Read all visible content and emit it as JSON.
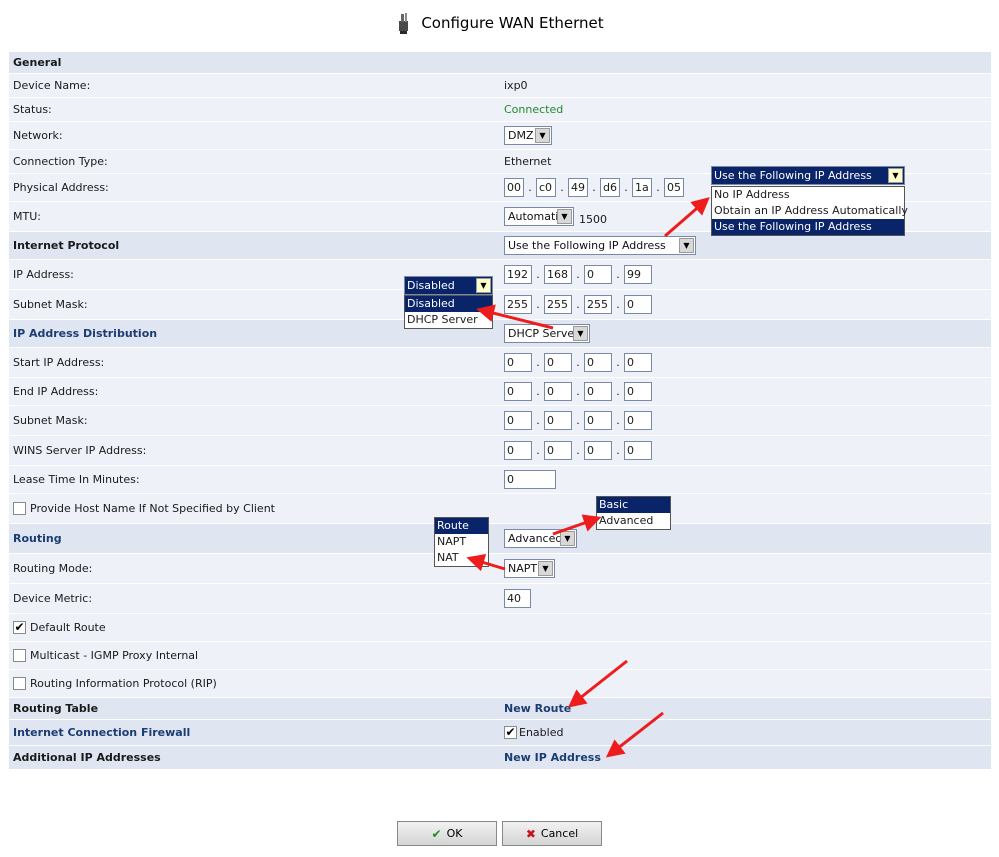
{
  "page": {
    "title": "Configure WAN Ethernet",
    "icon": "ethernet-plug-icon"
  },
  "general": {
    "header": "General",
    "device_name": {
      "label": "Device Name:",
      "value": "ixp0"
    },
    "status": {
      "label": "Status:",
      "value": "Connected",
      "color": "#1f8c2d"
    },
    "network": {
      "label": "Network:",
      "value": "DMZ"
    },
    "connection_type": {
      "label": "Connection Type:",
      "value": "Ethernet"
    },
    "physical_address": {
      "label": "Physical Address:",
      "octets": [
        "00",
        "c0",
        "49",
        "d6",
        "1a",
        "05"
      ]
    },
    "mtu": {
      "label": "MTU:",
      "mode": "Automatic",
      "value": "1500"
    }
  },
  "internet_protocol": {
    "header": "Internet Protocol",
    "mode": "Use the Following IP Address",
    "ip_address": {
      "label": "IP Address:",
      "octets": [
        "192",
        "168",
        "0",
        "99"
      ]
    },
    "subnet_mask": {
      "label": "Subnet Mask:",
      "octets": [
        "255",
        "255",
        "255",
        "0"
      ]
    }
  },
  "ip_distribution": {
    "header": "IP Address Distribution",
    "mode": "DHCP Server",
    "start_ip": {
      "label": "Start IP Address:",
      "octets": [
        "0",
        "0",
        "0",
        "0"
      ]
    },
    "end_ip": {
      "label": "End IP Address:",
      "octets": [
        "0",
        "0",
        "0",
        "0"
      ]
    },
    "subnet_mask": {
      "label": "Subnet Mask:",
      "octets": [
        "0",
        "0",
        "0",
        "0"
      ]
    },
    "wins": {
      "label": "WINS Server IP Address:",
      "octets": [
        "0",
        "0",
        "0",
        "0"
      ]
    },
    "lease_time": {
      "label": "Lease Time In Minutes:",
      "value": "0"
    },
    "provide_host_name": {
      "label": "Provide Host Name If Not Specified by Client",
      "checked": false
    }
  },
  "routing": {
    "header": "Routing",
    "mode_value": "Advanced",
    "routing_mode": {
      "label": "Routing Mode:",
      "value": "NAPT"
    },
    "device_metric": {
      "label": "Device Metric:",
      "value": "40"
    },
    "default_route": {
      "label": "Default Route",
      "checked": true
    },
    "multicast": {
      "label": "Multicast - IGMP Proxy Internal",
      "checked": false
    },
    "rip": {
      "label": "Routing Information Protocol (RIP)",
      "checked": false
    }
  },
  "routing_table": {
    "label": "Routing Table",
    "link": "New Route"
  },
  "firewall": {
    "label": "Internet Connection Firewall",
    "enabled_label": "Enabled",
    "checked": true
  },
  "additional_ip": {
    "label": "Additional IP Addresses",
    "link": "New IP Address"
  },
  "popups": {
    "ip_mode": {
      "selected": "Use the Following IP Address",
      "options": [
        "No IP Address",
        "Obtain an IP Address Automatically",
        "Use the Following IP Address"
      ]
    },
    "distribution": {
      "selected": "Disabled",
      "options": [
        "Disabled",
        "DHCP Server"
      ]
    },
    "routing_level": {
      "options": [
        "Basic",
        "Advanced"
      ]
    },
    "routing_mode": {
      "options": [
        "Route",
        "NAPT",
        "NAT"
      ]
    }
  },
  "buttons": {
    "ok": "OK",
    "cancel": "Cancel"
  },
  "colors": {
    "header_row": "#dfe5f1",
    "row": "#eef1f8",
    "selected": "#0a246a",
    "annotation_arrow": "#ee1c1c"
  }
}
